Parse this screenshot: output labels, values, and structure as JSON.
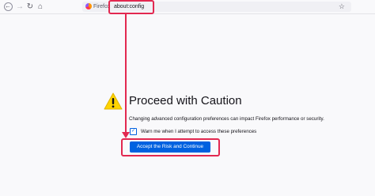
{
  "toolbar": {
    "back_icon": "←",
    "forward_icon": "→",
    "reload_icon": "↻",
    "home_icon": "⌂",
    "identity_label": "Firefox",
    "url": "about:config",
    "bookmark_icon": "☆"
  },
  "warning": {
    "icon": "warning-triangle",
    "title": "Proceed with Caution",
    "description": "Changing advanced configuration preferences can impact Firefox performance or security.",
    "checkbox_label": "Warn me when I attempt to access these preferences",
    "checkbox_checked": true,
    "accept_button": "Accept the Risk and Continue"
  },
  "colors": {
    "accent": "#0061e0",
    "annotation": "#e22850",
    "warning": "#ffd400"
  }
}
